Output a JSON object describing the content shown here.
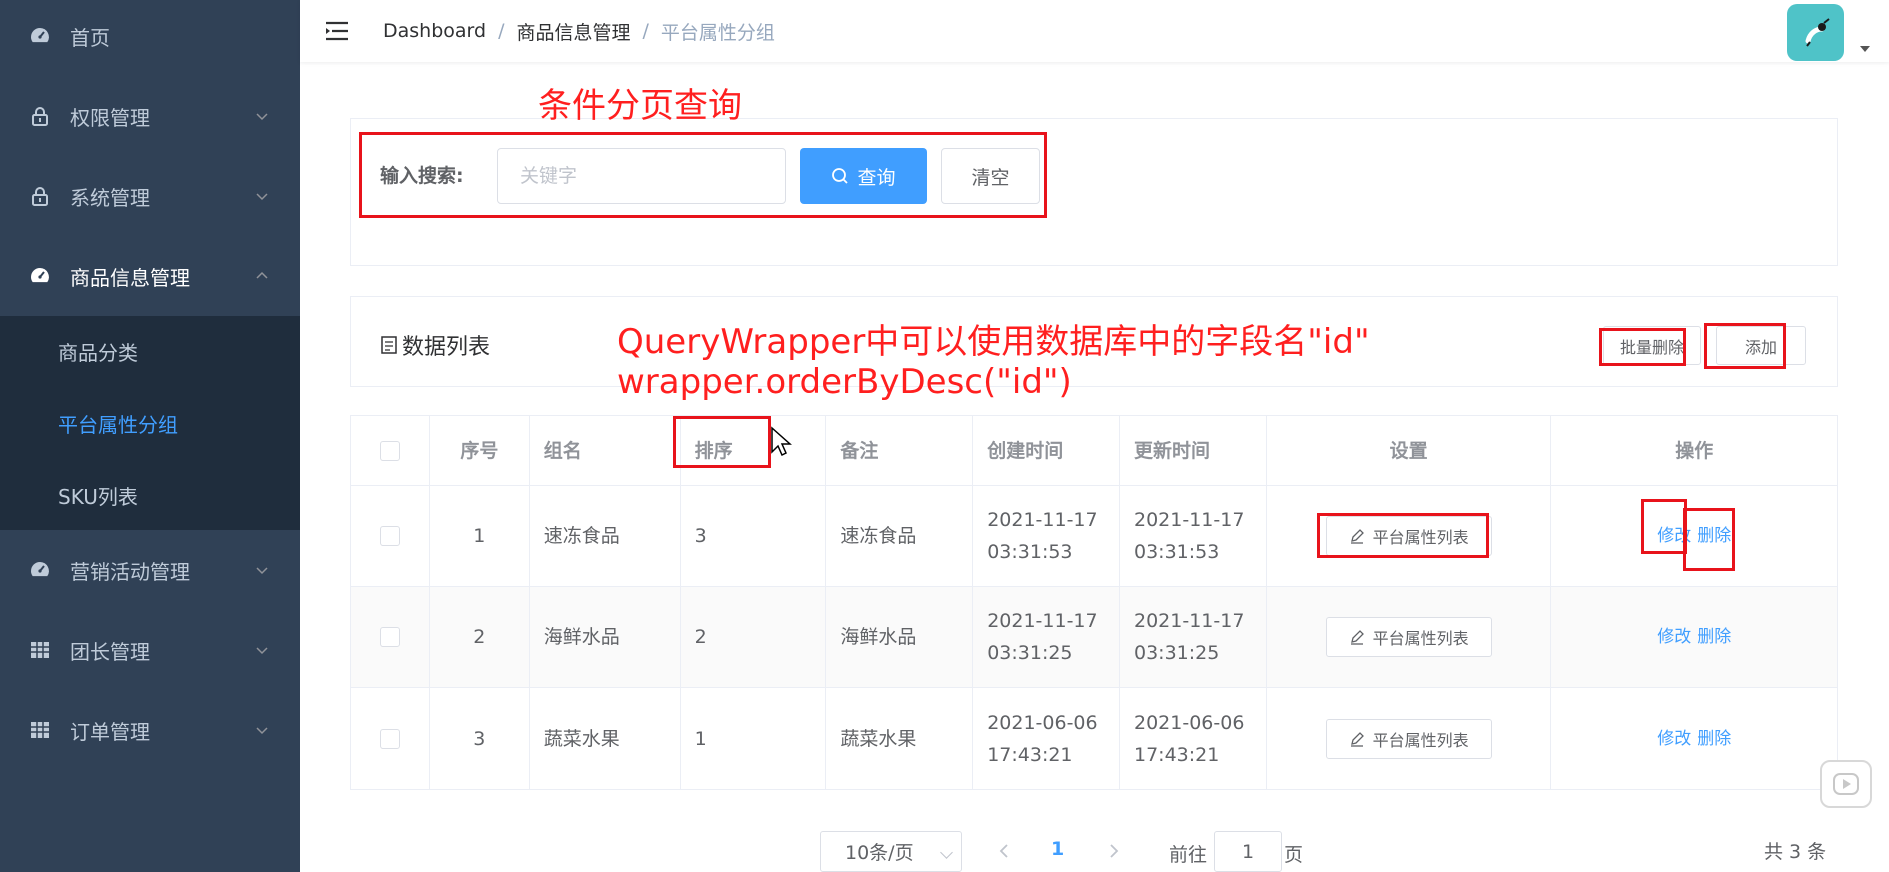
{
  "sidebar": {
    "items": [
      {
        "label": "首页",
        "icon": "dashboard-icon",
        "arrow": "none"
      },
      {
        "label": "权限管理",
        "icon": "lock-icon",
        "arrow": "down"
      },
      {
        "label": "系统管理",
        "icon": "lock-icon",
        "arrow": "down"
      },
      {
        "label": "商品信息管理",
        "icon": "dashboard-icon",
        "arrow": "up"
      },
      {
        "label": "营销活动管理",
        "icon": "dashboard-icon",
        "arrow": "down"
      },
      {
        "label": "团长管理",
        "icon": "table-icon",
        "arrow": "down"
      },
      {
        "label": "订单管理",
        "icon": "table-icon",
        "arrow": "down"
      }
    ],
    "submenu": [
      {
        "label": "商品分类",
        "active": false
      },
      {
        "label": "平台属性分组",
        "active": true
      },
      {
        "label": "SKU列表",
        "active": false
      }
    ]
  },
  "header": {
    "breadcrumb": [
      "Dashboard",
      "商品信息管理",
      "平台属性分组"
    ]
  },
  "search": {
    "label": "输入搜索:",
    "placeholder": "关键字",
    "value": "",
    "query_button": "查询",
    "clear_button": "清空"
  },
  "list": {
    "title": "数据列表",
    "batch_delete": "批量删除",
    "add": "添加"
  },
  "table": {
    "columns": [
      "",
      "序号",
      "组名",
      "排序",
      "备注",
      "创建时间",
      "更新时间",
      "设置",
      "操作"
    ],
    "rows": [
      {
        "index": "1",
        "name": "速冻食品",
        "sort": "3",
        "remark": "速冻食品",
        "created": "2021-11-17 03:31:53",
        "updated": "2021-11-17 03:31:53"
      },
      {
        "index": "2",
        "name": "海鲜水品",
        "sort": "2",
        "remark": "海鲜水品",
        "created": "2021-11-17 03:31:25",
        "updated": "2021-11-17 03:31:25"
      },
      {
        "index": "3",
        "name": "蔬菜水果",
        "sort": "1",
        "remark": "蔬菜水果",
        "created": "2021-06-06 17:43:21",
        "updated": "2021-06-06 17:43:21"
      }
    ],
    "attr_button": "平台属性列表",
    "edit": "修改",
    "delete": "删除"
  },
  "pagination": {
    "page_size": "10条/页",
    "current": "1",
    "goto_prefix": "前往",
    "goto_value": "1",
    "goto_suffix": "页",
    "total": "共 3 条"
  },
  "annotations": {
    "title": "条件分页查询",
    "line1": "QueryWrapper中可以使用数据库中的字段名\"id\"",
    "line2": "wrapper.orderByDesc(\"id\")"
  },
  "colors": {
    "sidebar_bg": "#304156",
    "submenu_bg": "#1f2d3d",
    "accent": "#409eff",
    "annotation_red": "#e8131b"
  }
}
